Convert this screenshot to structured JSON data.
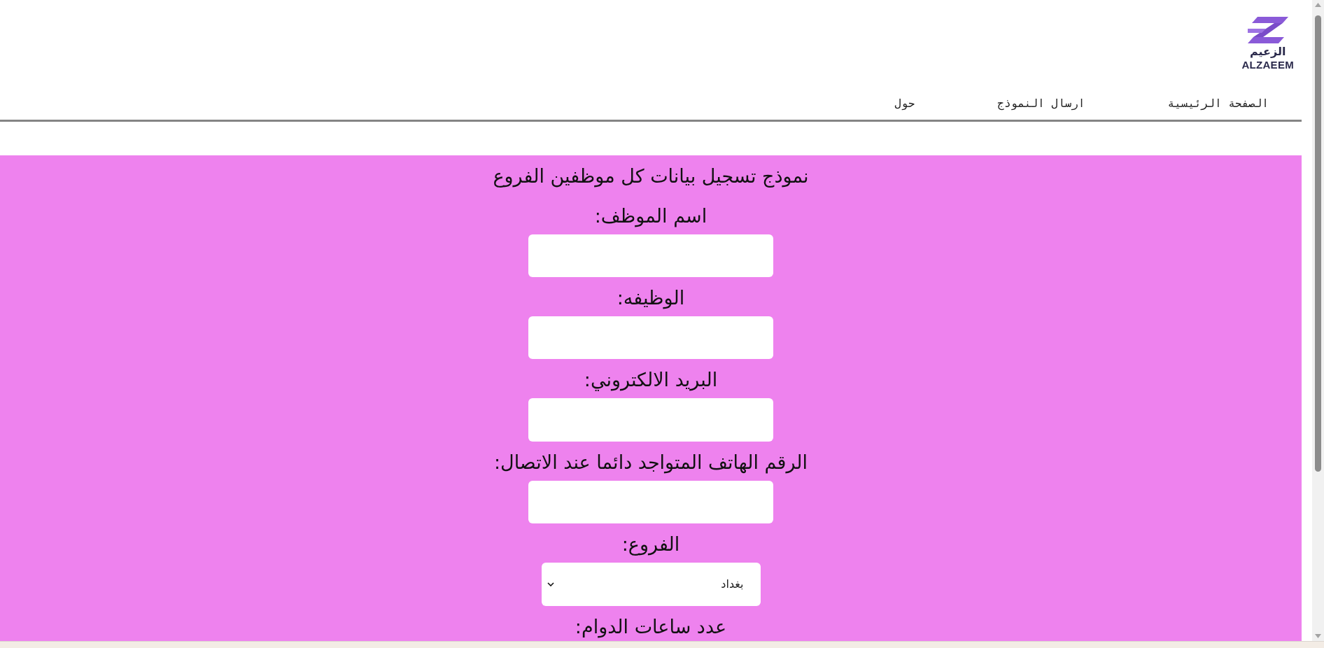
{
  "logo": {
    "arabic": "الزعيم",
    "latin": "ALZAEEM"
  },
  "nav": [
    "الصفحة الرئيسية",
    "ارسال النموذج",
    "حول"
  ],
  "form": {
    "title": "نموذج تسجيل بيانات كل موظفين الفروع",
    "fields": [
      {
        "kind": "text",
        "label": "اسم الموظف:"
      },
      {
        "kind": "text",
        "label": "الوظيفه:"
      },
      {
        "kind": "text",
        "label": "البريد الالكتروني:"
      },
      {
        "kind": "text",
        "label": "الرقم الهاتف المتواجد دائما عند الاتصال:"
      },
      {
        "kind": "select",
        "label": "الفروع:",
        "value": "بغداد"
      },
      {
        "kind": "label",
        "label": "عدد ساعات الدوام:"
      }
    ]
  }
}
